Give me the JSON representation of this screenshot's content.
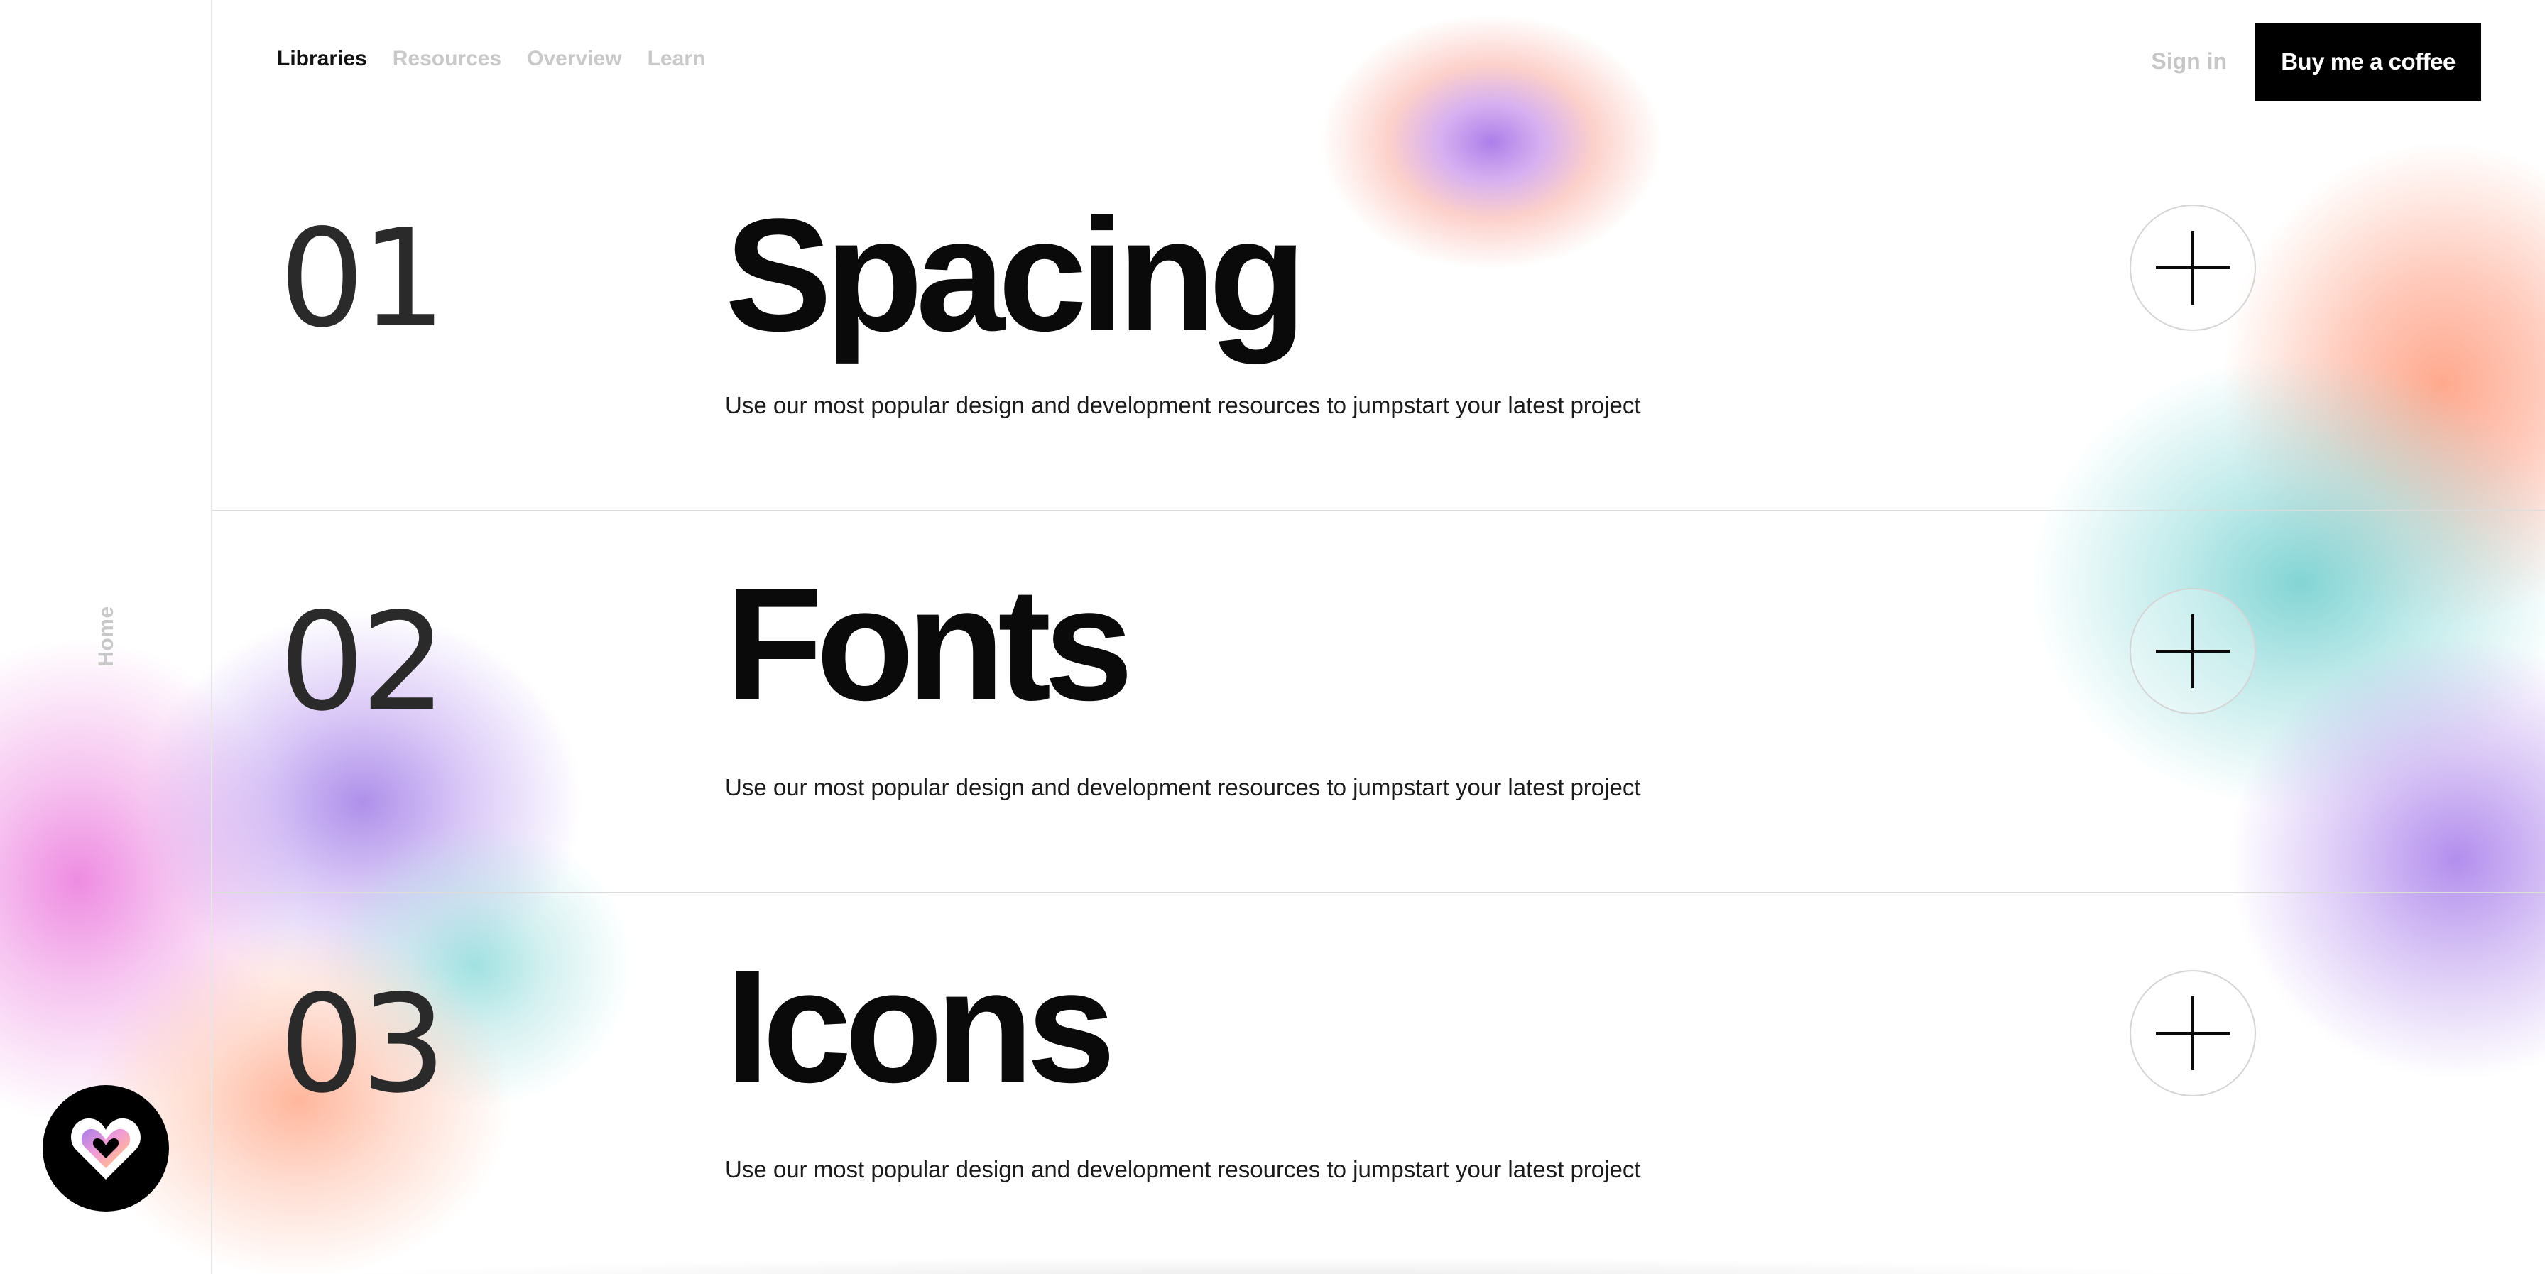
{
  "header": {
    "nav": [
      {
        "label": "Libraries",
        "active": true
      },
      {
        "label": "Resources",
        "active": false
      },
      {
        "label": "Overview",
        "active": false
      },
      {
        "label": "Learn",
        "active": false
      }
    ],
    "sign_in": "Sign in",
    "cta": "Buy me a coffee"
  },
  "sidebar": {
    "vertical_label": "Home",
    "logo_icon": "heart-logo-icon"
  },
  "sections": [
    {
      "number": "01",
      "title": "Spacing",
      "description": "Use our most popular design and development resources to jumpstart your latest project",
      "action_icon": "plus-icon"
    },
    {
      "number": "02",
      "title": "Fonts",
      "description": "Use our most popular design and development resources to jumpstart your latest project",
      "action_icon": "plus-icon"
    },
    {
      "number": "03",
      "title": "Icons",
      "description": "Use our most popular design and development resources to jumpstart your latest project",
      "action_icon": "plus-icon"
    }
  ],
  "colors": {
    "background": "#ffffff",
    "text": "#0b0b0b",
    "muted": "#c9c9c9",
    "cta_bg": "#000000",
    "cta_text": "#ffffff",
    "divider": "#dcdcdc"
  }
}
